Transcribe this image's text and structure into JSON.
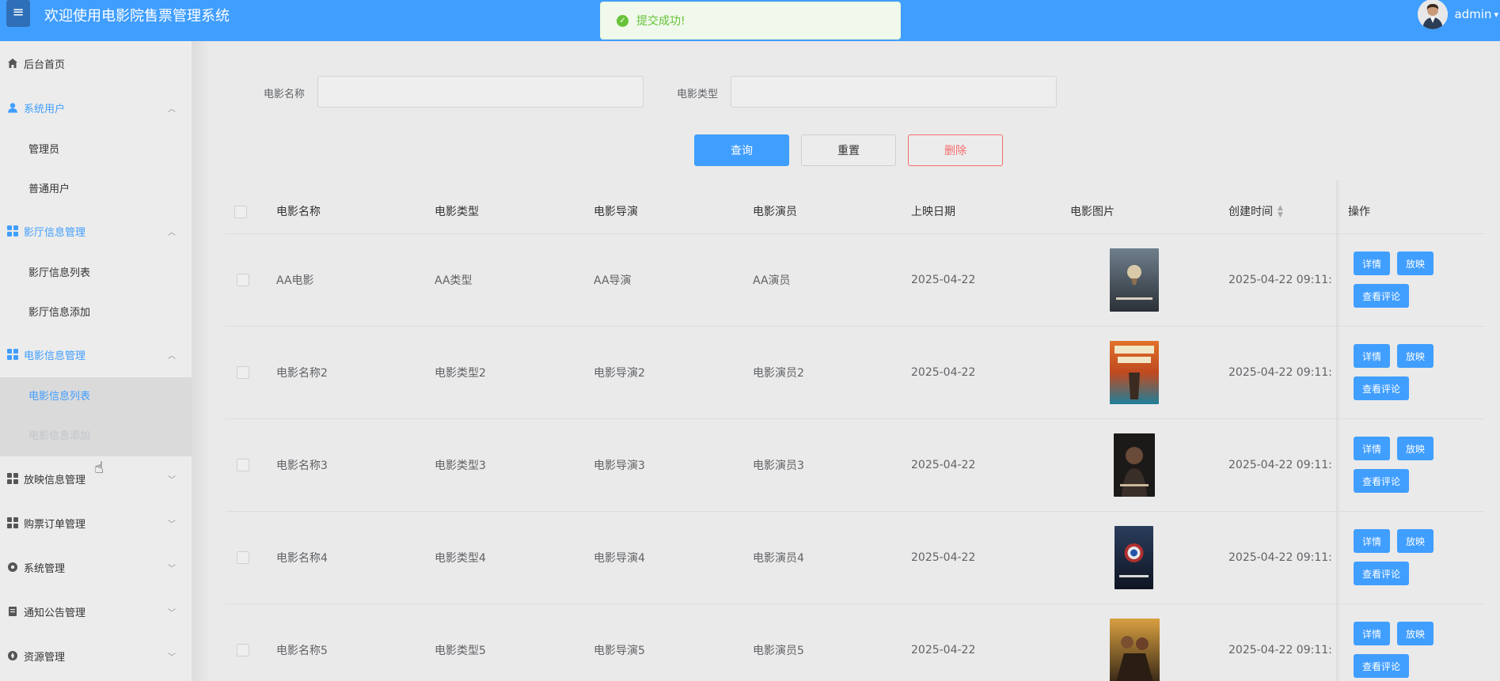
{
  "header": {
    "menu_icon": "hamburger-icon",
    "title": "欢迎使用电影院售票管理系统",
    "user_name": "admin"
  },
  "toast": {
    "message": "提交成功!",
    "icon": "success-check-icon",
    "color": "#67c23a"
  },
  "sidebar": {
    "home": "后台首页",
    "system_users": {
      "label": "系统用户",
      "items": [
        "管理员",
        "普通用户"
      ]
    },
    "hall": {
      "label": "影厅信息管理",
      "items": [
        "影厅信息列表",
        "影厅信息添加"
      ]
    },
    "movie": {
      "label": "电影信息管理",
      "items": [
        "电影信息列表",
        "电影信息添加"
      ]
    },
    "screening": "放映信息管理",
    "orders": "购票订单管理",
    "system": "系统管理",
    "notice": "通知公告管理",
    "resources": "资源管理"
  },
  "search": {
    "name_label": "电影名称",
    "name_value": "",
    "type_label": "电影类型",
    "type_value": "",
    "query_btn": "查询",
    "reset_btn": "重置",
    "delete_btn": "删除"
  },
  "table": {
    "columns": {
      "name": "电影名称",
      "type": "电影类型",
      "director": "电影导演",
      "actor": "电影演员",
      "release": "上映日期",
      "image": "电影图片",
      "created": "创建时间",
      "ops": "操作"
    },
    "rows": [
      {
        "name": "AA电影",
        "type": "AA类型",
        "director": "AA导演",
        "actor": "AA演员",
        "release": "2025-04-22",
        "created": "2025-04-22 09:11:",
        "poster": "hot-air-balloon-poster"
      },
      {
        "name": "电影名称2",
        "type": "电影类型2",
        "director": "电影导演2",
        "actor": "电影演员2",
        "release": "2025-04-22",
        "created": "2025-04-22 09:11:",
        "poster": "godzilla-kong-poster"
      },
      {
        "name": "电影名称3",
        "type": "电影类型3",
        "director": "电影导演3",
        "actor": "电影演员3",
        "release": "2025-04-22",
        "created": "2025-04-22 09:11:",
        "poster": "dark-figure-poster"
      },
      {
        "name": "电影名称4",
        "type": "电影类型4",
        "director": "电影导演4",
        "actor": "电影演员4",
        "release": "2025-04-22",
        "created": "2025-04-22 09:11:",
        "poster": "captain-america-poster"
      },
      {
        "name": "电影名称5",
        "type": "电影类型5",
        "director": "电影导演5",
        "actor": "电影演员5",
        "release": "2025-04-22",
        "created": "2025-04-22 09:11:",
        "poster": "adventure-poster"
      }
    ],
    "actions": {
      "detail": "详情",
      "screen": "放映",
      "comments": "查看评论"
    }
  },
  "colors": {
    "primary": "#409eff",
    "danger": "#f56c6c",
    "success": "#67c23a"
  }
}
